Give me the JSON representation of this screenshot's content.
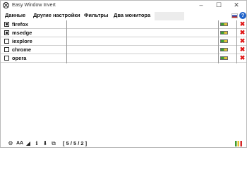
{
  "window": {
    "title": "Easy Window Invert",
    "controls": {
      "minimize": "–",
      "maximize": "☐",
      "close": "✕"
    }
  },
  "menu": {
    "items": [
      "Данные",
      "Другие настройки",
      "Фильтры",
      "Два монитора"
    ],
    "language_icon": "russian-flag-icon",
    "help_icon": "?"
  },
  "processes": [
    {
      "name": "firefox",
      "checked": true
    },
    {
      "name": "msedge",
      "checked": true
    },
    {
      "name": "iexplore",
      "checked": false
    },
    {
      "name": "chrome",
      "checked": false
    },
    {
      "name": "opera",
      "checked": false
    }
  ],
  "row_delete_glyph": "✖",
  "statusbar": {
    "icons": [
      "gear-icon",
      "font-icon",
      "triangle-icon",
      "info-icon",
      "download-icon",
      "copy-icon"
    ],
    "counter": "[ 5 / 5 / 2 ]"
  },
  "colors": {
    "accent_red": "#e01515",
    "help_blue": "#2063c9",
    "toggle_green": "#3d9c33",
    "toggle_yellow": "#e0c13a"
  }
}
